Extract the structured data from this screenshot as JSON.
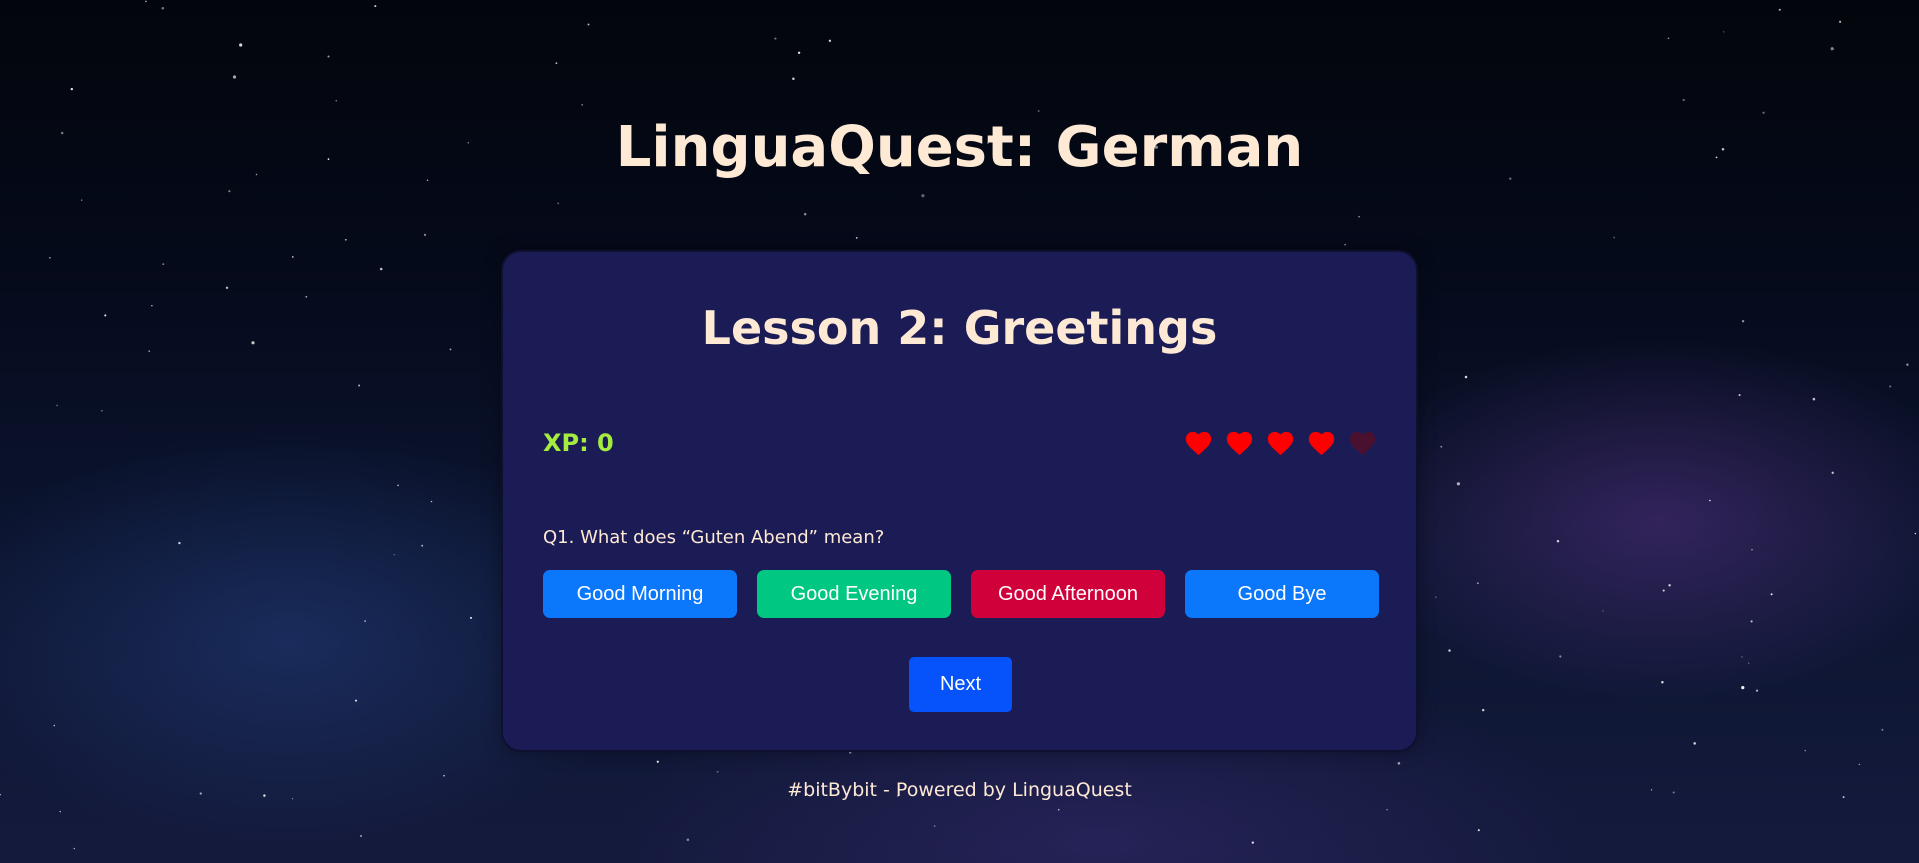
{
  "app": {
    "title": "LinguaQuest: German"
  },
  "lesson": {
    "title": "Lesson 2: Greetings",
    "xp_label": "XP: 0",
    "lives": {
      "total": 5,
      "remaining": 4,
      "full_color": "#ff0000",
      "empty_color": "#4a1030"
    },
    "question": "Q1. What does “Guten Abend” mean?",
    "options": [
      {
        "label": "Good Morning",
        "color": "#0b77fb",
        "state": "default"
      },
      {
        "label": "Good Evening",
        "color": "#00c782",
        "state": "correct"
      },
      {
        "label": "Good Afternoon",
        "color": "#d0003a",
        "state": "wrong"
      },
      {
        "label": "Good Bye",
        "color": "#0b77fb",
        "state": "default"
      }
    ],
    "next_label": "Next",
    "next_color": "#0753fb"
  },
  "footer": {
    "text": "#bitBybit - Powered by LinguaQuest"
  },
  "icons": {
    "life": "heart-icon"
  }
}
